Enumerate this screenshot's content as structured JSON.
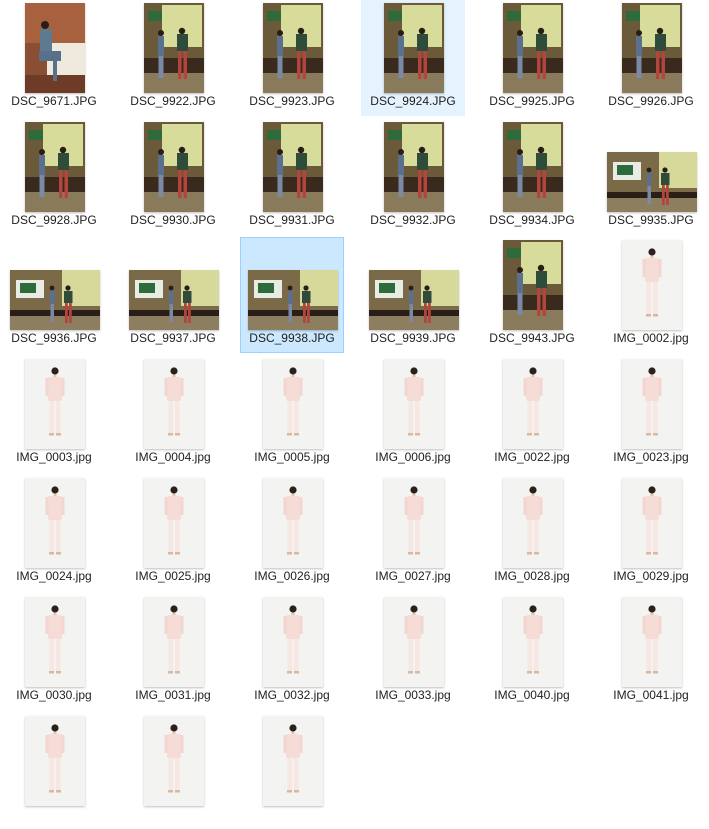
{
  "files": [
    {
      "name": "DSC_9671.JPG",
      "kind": "sofa",
      "orientation": "portrait"
    },
    {
      "name": "DSC_9922.JPG",
      "kind": "stage",
      "orientation": "portrait"
    },
    {
      "name": "DSC_9923.JPG",
      "kind": "stage",
      "orientation": "portrait"
    },
    {
      "name": "DSC_9924.JPG",
      "kind": "stage",
      "orientation": "portrait",
      "state": "hover"
    },
    {
      "name": "DSC_9925.JPG",
      "kind": "stage",
      "orientation": "portrait"
    },
    {
      "name": "DSC_9926.JPG",
      "kind": "stage",
      "orientation": "portrait"
    },
    {
      "name": "DSC_9928.JPG",
      "kind": "stage",
      "orientation": "portrait"
    },
    {
      "name": "DSC_9930.JPG",
      "kind": "stage",
      "orientation": "portrait"
    },
    {
      "name": "DSC_9931.JPG",
      "kind": "stage",
      "orientation": "portrait"
    },
    {
      "name": "DSC_9932.JPG",
      "kind": "stage",
      "orientation": "portrait"
    },
    {
      "name": "DSC_9934.JPG",
      "kind": "stage",
      "orientation": "portrait"
    },
    {
      "name": "DSC_9935.JPG",
      "kind": "stage-wide",
      "orientation": "landscape"
    },
    {
      "name": "DSC_9936.JPG",
      "kind": "stage-wide",
      "orientation": "landscape"
    },
    {
      "name": "DSC_9937.JPG",
      "kind": "stage-wide",
      "orientation": "landscape"
    },
    {
      "name": "DSC_9938.JPG",
      "kind": "stage-wide",
      "orientation": "landscape",
      "state": "selected"
    },
    {
      "name": "DSC_9939.JPG",
      "kind": "stage-wide",
      "orientation": "landscape"
    },
    {
      "name": "DSC_9943.JPG",
      "kind": "stage",
      "orientation": "portrait"
    },
    {
      "name": "IMG_0002.jpg",
      "kind": "studio",
      "orientation": "portrait"
    },
    {
      "name": "IMG_0003.jpg",
      "kind": "studio",
      "orientation": "portrait"
    },
    {
      "name": "IMG_0004.jpg",
      "kind": "studio",
      "orientation": "portrait"
    },
    {
      "name": "IMG_0005.jpg",
      "kind": "studio",
      "orientation": "portrait"
    },
    {
      "name": "IMG_0006.jpg",
      "kind": "studio",
      "orientation": "portrait"
    },
    {
      "name": "IMG_0022.jpg",
      "kind": "studio",
      "orientation": "portrait"
    },
    {
      "name": "IMG_0023.jpg",
      "kind": "studio",
      "orientation": "portrait"
    },
    {
      "name": "IMG_0024.jpg",
      "kind": "studio",
      "orientation": "portrait"
    },
    {
      "name": "IMG_0025.jpg",
      "kind": "studio",
      "orientation": "portrait"
    },
    {
      "name": "IMG_0026.jpg",
      "kind": "studio",
      "orientation": "portrait"
    },
    {
      "name": "IMG_0027.jpg",
      "kind": "studio",
      "orientation": "portrait"
    },
    {
      "name": "IMG_0028.jpg",
      "kind": "studio",
      "orientation": "portrait"
    },
    {
      "name": "IMG_0029.jpg",
      "kind": "studio",
      "orientation": "portrait"
    },
    {
      "name": "IMG_0030.jpg",
      "kind": "studio",
      "orientation": "portrait"
    },
    {
      "name": "IMG_0031.jpg",
      "kind": "studio",
      "orientation": "portrait"
    },
    {
      "name": "IMG_0032.jpg",
      "kind": "studio",
      "orientation": "portrait"
    },
    {
      "name": "IMG_0033.jpg",
      "kind": "studio",
      "orientation": "portrait"
    },
    {
      "name": "IMG_0040.jpg",
      "kind": "studio",
      "orientation": "portrait"
    },
    {
      "name": "IMG_0041.jpg",
      "kind": "studio",
      "orientation": "portrait"
    },
    {
      "name": "",
      "kind": "studio",
      "orientation": "portrait",
      "partial": true
    },
    {
      "name": "",
      "kind": "studio",
      "orientation": "portrait",
      "partial": true
    },
    {
      "name": "",
      "kind": "studio",
      "orientation": "portrait",
      "partial": true
    }
  ]
}
